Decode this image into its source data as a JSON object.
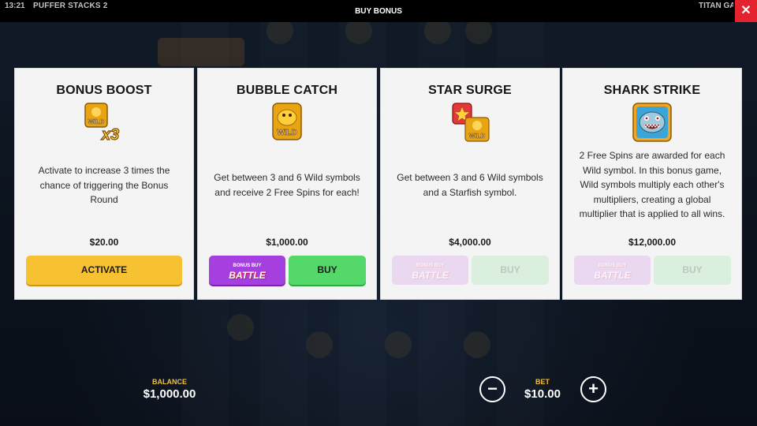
{
  "topbar": {
    "time": "13:21",
    "game_name": "PUFFER STACKS 2",
    "dialog_title": "BUY BONUS",
    "provider": "TITAN GA",
    "close_icon": "close-icon"
  },
  "cards": [
    {
      "title": "BONUS BOOST",
      "icon": "wild-x3-icon",
      "description": "Activate to increase 3 times the chance of triggering the Bonus Round",
      "price": "$20.00",
      "buttons": [
        {
          "label": "ACTIVATE",
          "enabled": true
        }
      ]
    },
    {
      "title": "BUBBLE CATCH",
      "icon": "golden-fish-wild-icon",
      "description": "Get between 3 and 6 Wild symbols and receive 2 Free Spins for each!",
      "price": "$1,000.00",
      "buttons": [
        {
          "label_top": "BONUS BUY",
          "label_main": "BATTLE",
          "enabled": true
        },
        {
          "label": "BUY",
          "enabled": true
        }
      ]
    },
    {
      "title": "STAR SURGE",
      "icon": "starfish-wild-icon",
      "description": "Get between 3 and 6 Wild symbols and a Starfish symbol.",
      "price": "$4,000.00",
      "buttons": [
        {
          "label_top": "BONUS BUY",
          "label_main": "BATTLE",
          "enabled": false
        },
        {
          "label": "BUY",
          "enabled": false
        }
      ]
    },
    {
      "title": "SHARK STRIKE",
      "icon": "shark-icon",
      "description": "2 Free Spins are awarded for each Wild symbol. In this bonus game, Wild symbols multiply each other's multipliers, creating a global multiplier that is applied to all wins.",
      "price": "$12,000.00",
      "buttons": [
        {
          "label_top": "BONUS BUY",
          "label_main": "BATTLE",
          "enabled": false
        },
        {
          "label": "BUY",
          "enabled": false
        }
      ]
    }
  ],
  "footer": {
    "balance_label": "BALANCE",
    "balance_value": "$1,000.00",
    "bet_label": "BET",
    "bet_value": "$10.00",
    "minus_icon": "minus-icon",
    "plus_icon": "plus-icon"
  },
  "colors": {
    "activate": "#f6c232",
    "battle": "#a63fe0",
    "buy": "#54d86a",
    "close": "#e5232e",
    "footer_label": "#f2c038"
  }
}
